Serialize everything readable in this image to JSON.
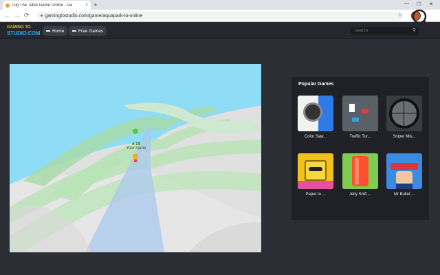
{
  "browser": {
    "tab_title": "Tug The Table Game Online - Ga",
    "tab_close": "×",
    "new_tab": "+",
    "back": "←",
    "forward": "→",
    "reload": "⟳",
    "url": "gamingtostudio.com/game/aquapark-io-online",
    "minimize": "—",
    "maximize": "☐",
    "close": "✕",
    "menu": "⋮"
  },
  "site": {
    "logo_line1": "GAMING TO",
    "logo_line2": "STUDIO.COM",
    "nav": [
      {
        "label": "Home",
        "icon": "home-icon"
      },
      {
        "label": "Free Games",
        "icon": "gamepad-icon"
      }
    ],
    "search_placeholder": "Search"
  },
  "game": {
    "player_rank": "# 10",
    "player_name": "Your name"
  },
  "popular": {
    "heading": "Popular Games",
    "games": [
      {
        "name": "Color Saw...",
        "color": "#2e7be8"
      },
      {
        "name": "Traffic Tur...",
        "color": "#5a6068"
      },
      {
        "name": "Sniper Mis...",
        "color": "#444"
      },
      {
        "name": "Paper io ...",
        "color": "#f1c21b"
      },
      {
        "name": "Jelly Shift ...",
        "color": "#ff4f2e"
      },
      {
        "name": "Mr Bullet ...",
        "color": "#3b8be0"
      }
    ]
  }
}
